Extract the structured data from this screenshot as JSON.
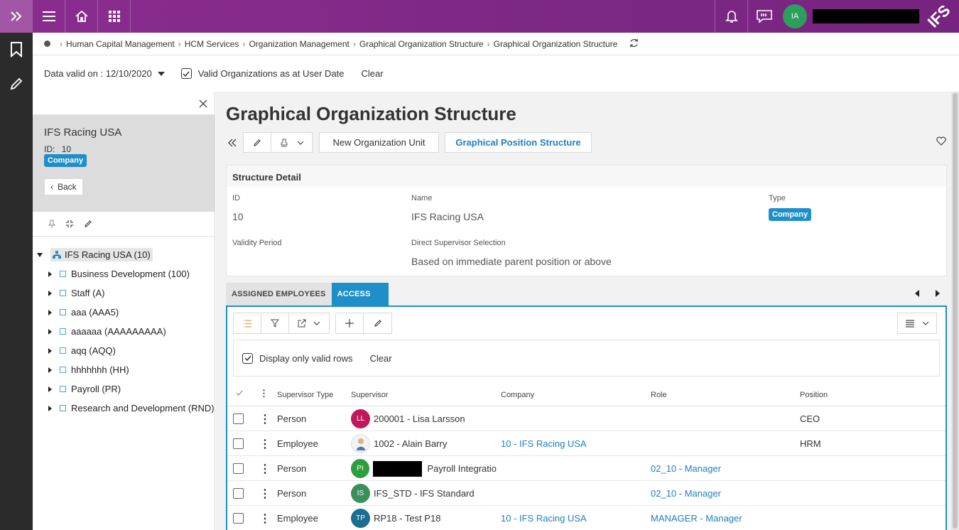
{
  "topbar": {
    "user_initials": "IA",
    "brand": "IFS"
  },
  "breadcrumb": [
    "Human Capital Management",
    "HCM Services",
    "Organization Management",
    "Graphical Organization Structure",
    "Graphical Organization Structure"
  ],
  "filter": {
    "data_valid_label": "Data valid on : 12/10/2020",
    "valid_orgs_label": "Valid Organizations as at User Date",
    "clear_label": "Clear"
  },
  "left_panel": {
    "title": "IFS Racing USA",
    "id_label": "ID:",
    "id_value": "10",
    "badge": "Company",
    "back_label": "Back",
    "tree_root": "IFS Racing USA (10)",
    "tree_items": [
      "Business Development (100)",
      "Staff (A)",
      "aaa (AAA5)",
      "aaaaaa (AAAAAAAAA)",
      "aqq (AQQ)",
      "hhhhhhh (HH)",
      "Payroll (PR)",
      "Research and Development (RND)"
    ]
  },
  "main": {
    "title": "Graphical Organization Structure",
    "new_org_unit_label": "New Organization Unit",
    "graph_position_label": "Graphical Position Structure",
    "detail": {
      "header": "Structure Detail",
      "id_label": "ID",
      "id_value": "10",
      "name_label": "Name",
      "name_value": "IFS Racing USA",
      "type_label": "Type",
      "type_value": "Company",
      "validity_label": "Validity Period",
      "supervisor_sel_label": "Direct Supervisor Selection",
      "supervisor_sel_value": "Based on immediate parent position or above"
    },
    "tabs": [
      "ASSIGNED EMPLOYEES",
      "ACCESS"
    ],
    "grid": {
      "filter_label": "Display only valid rows",
      "filter_clear": "Clear",
      "columns": [
        "Supervisor Type",
        "Supervisor",
        "Company",
        "Role",
        "Position"
      ],
      "rows": [
        {
          "type": "Person",
          "initials": "LL",
          "avatar_color": "#c2185b",
          "supervisor": "200001 - Lisa Larsson",
          "company": "",
          "role": "",
          "position": "CEO"
        },
        {
          "type": "Employee",
          "initials": "",
          "avatar_color": "#ffffff",
          "supervisor": "1002 - Alain Barry",
          "company": "10 - IFS Racing USA",
          "role": "",
          "position": "HRM"
        },
        {
          "type": "Person",
          "initials": "PI",
          "avatar_color": "#2e9e3e",
          "supervisor": "Payroll Integratio",
          "company": "",
          "role": "02_10 - Manager",
          "position": ""
        },
        {
          "type": "Person",
          "initials": "IS",
          "avatar_color": "#3a8f5a",
          "supervisor": "IFS_STD - IFS Standard",
          "company": "",
          "role": "02_10 - Manager",
          "position": ""
        },
        {
          "type": "Employee",
          "initials": "TP",
          "avatar_color": "#1a6e8e",
          "supervisor": "RP18 - Test P18",
          "company": "10 - IFS Racing USA",
          "role": "MANAGER - Manager",
          "position": ""
        }
      ]
    }
  }
}
